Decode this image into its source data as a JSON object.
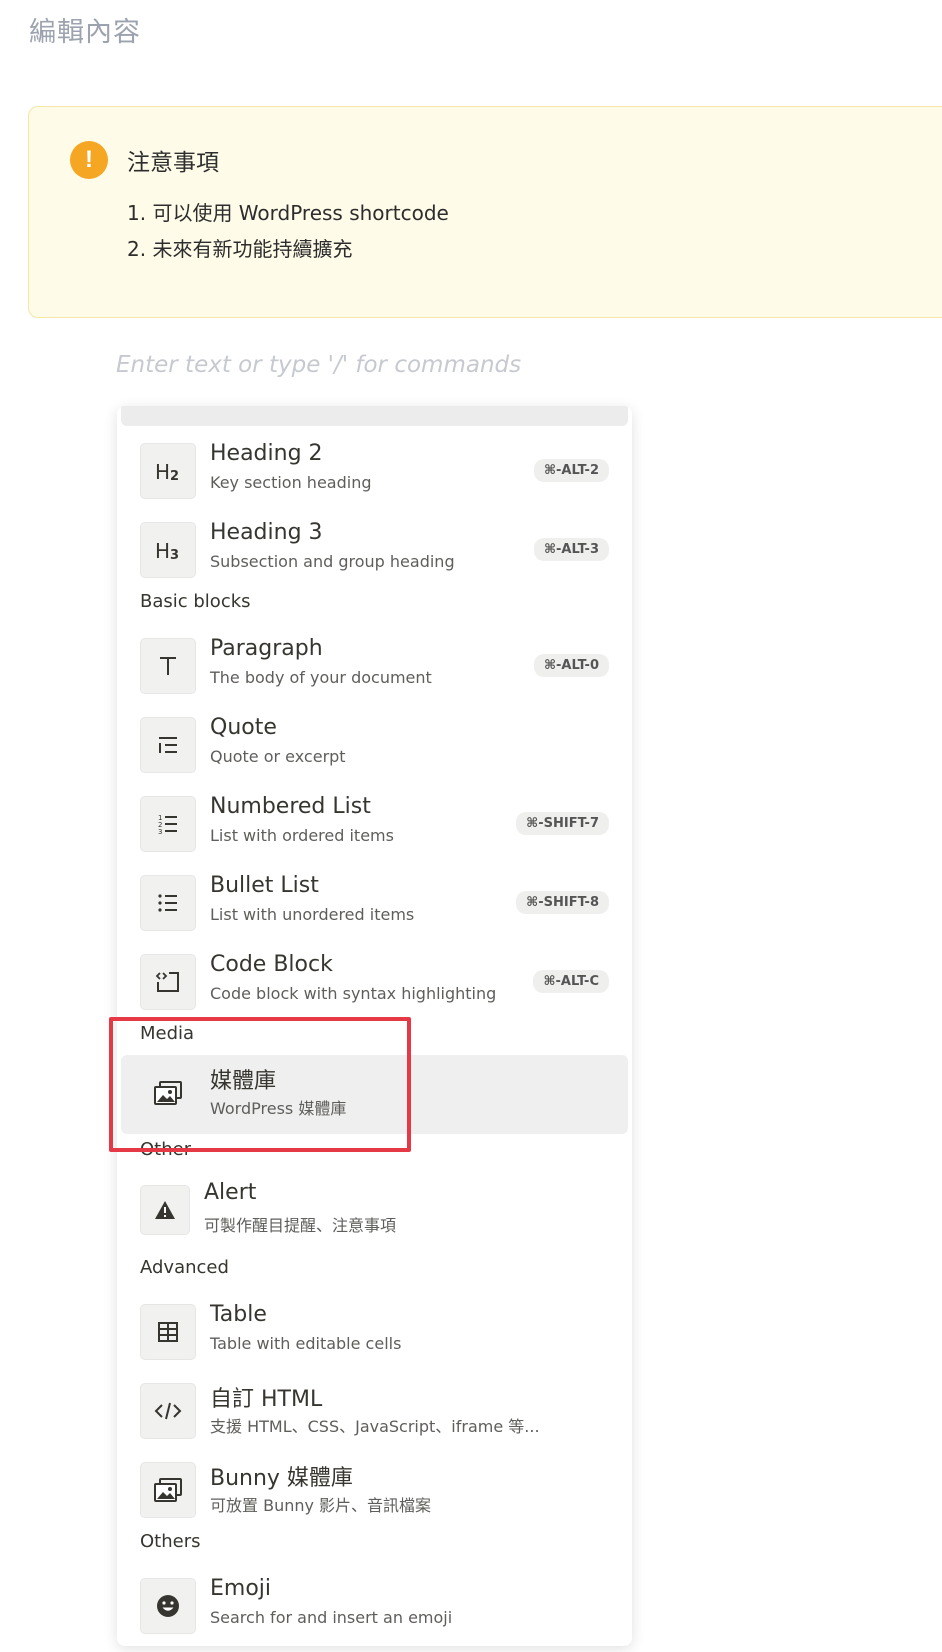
{
  "page": {
    "title": "編輯內容"
  },
  "notice": {
    "title": "注意事項",
    "items": [
      "1. 可以使用 WordPress shortcode",
      "2. 未來有新功能持續擴充"
    ],
    "icon": "exclamation-icon",
    "accent_color": "#f5a623"
  },
  "editor": {
    "placeholder": "Enter text or type '/' for commands"
  },
  "menu": {
    "sections": {
      "basic": "Basic blocks",
      "media": "Media",
      "other": "Other",
      "advanced": "Advanced",
      "others": "Others"
    },
    "items": [
      {
        "title": "Heading 2",
        "desc": "Key section heading",
        "shortcut": "⌘-ALT-2",
        "icon": "heading-2-icon"
      },
      {
        "title": "Heading 3",
        "desc": "Subsection and group heading",
        "shortcut": "⌘-ALT-3",
        "icon": "heading-3-icon"
      },
      {
        "title": "Paragraph",
        "desc": "The body of your document",
        "shortcut": "⌘-ALT-0",
        "icon": "text-icon"
      },
      {
        "title": "Quote",
        "desc": "Quote or excerpt",
        "shortcut": "",
        "icon": "quote-icon"
      },
      {
        "title": "Numbered List",
        "desc": "List with ordered items",
        "shortcut": "⌘-SHIFT-7",
        "icon": "numbered-list-icon"
      },
      {
        "title": "Bullet List",
        "desc": "List with unordered items",
        "shortcut": "⌘-SHIFT-8",
        "icon": "bullet-list-icon"
      },
      {
        "title": "Code Block",
        "desc": "Code block with syntax highlighting",
        "shortcut": "⌘-ALT-C",
        "icon": "code-block-icon"
      },
      {
        "title": "媒體庫",
        "desc": "WordPress 媒體庫",
        "shortcut": "",
        "icon": "media-library-icon",
        "selected": true
      },
      {
        "title": "Alert",
        "desc": "可製作醒目提醒、注意事項",
        "shortcut": "",
        "icon": "alert-icon"
      },
      {
        "title": "Table",
        "desc": "Table with editable cells",
        "shortcut": "",
        "icon": "table-icon"
      },
      {
        "title": "自訂 HTML",
        "desc": "支援 HTML、CSS、JavaScript、iframe 等...",
        "shortcut": "",
        "icon": "html-code-icon"
      },
      {
        "title": "Bunny 媒體庫",
        "desc": "可放置 Bunny 影片、音訊檔案",
        "shortcut": "",
        "icon": "bunny-media-icon"
      },
      {
        "title": "Emoji",
        "desc": "Search for and insert an emoji",
        "shortcut": "",
        "icon": "emoji-icon"
      }
    ]
  },
  "annotation": {
    "highlight_color": "#e53a45"
  }
}
